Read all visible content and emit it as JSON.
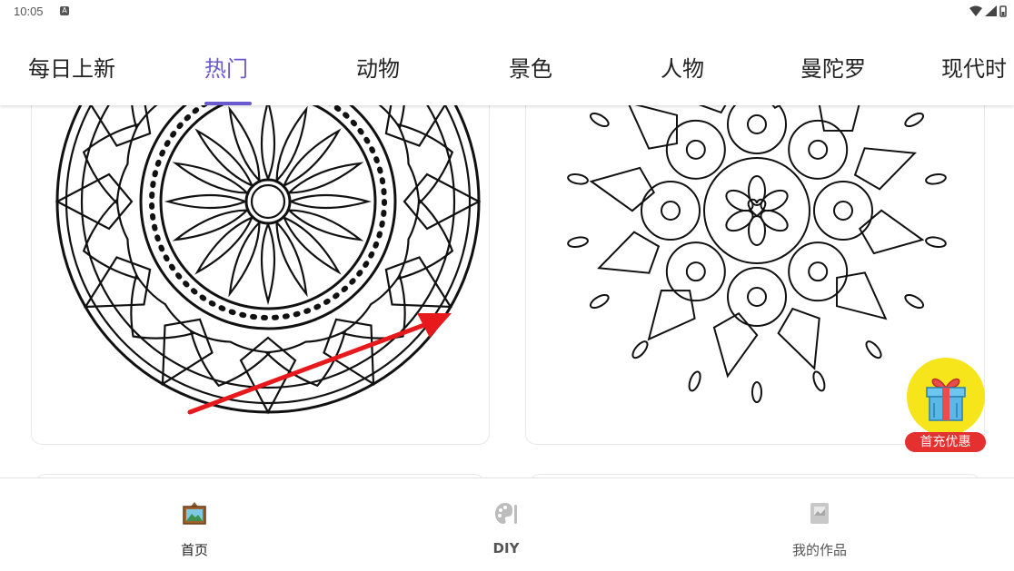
{
  "status_bar": {
    "time": "10:05",
    "notification_icon": "A"
  },
  "tabs": [
    {
      "label": "每日上新",
      "active": false
    },
    {
      "label": "热门",
      "active": true
    },
    {
      "label": "动物",
      "active": false
    },
    {
      "label": "景色",
      "active": false
    },
    {
      "label": "人物",
      "active": false
    },
    {
      "label": "曼陀罗",
      "active": false
    },
    {
      "label": "现代时",
      "active": false
    }
  ],
  "cards": [
    {
      "icon": "mandala-flower-icon"
    },
    {
      "icon": "mandala-ornament-icon"
    }
  ],
  "promo": {
    "badge": "首充优惠",
    "icon": "gift-box-icon"
  },
  "bottom_nav": [
    {
      "label": "首页",
      "icon": "framed-picture-icon",
      "active": true,
      "color": "#222222"
    },
    {
      "label": "DIY",
      "icon": "palette-icon",
      "active": false,
      "color": "#555555"
    },
    {
      "label": "我的作品",
      "icon": "artwork-folder-icon",
      "active": false,
      "color": "#555555"
    }
  ],
  "colors": {
    "accent": "#6a5acd",
    "promo_yellow": "#f7e51c",
    "promo_red": "#e53030",
    "annotation_arrow": "#e8191c"
  }
}
